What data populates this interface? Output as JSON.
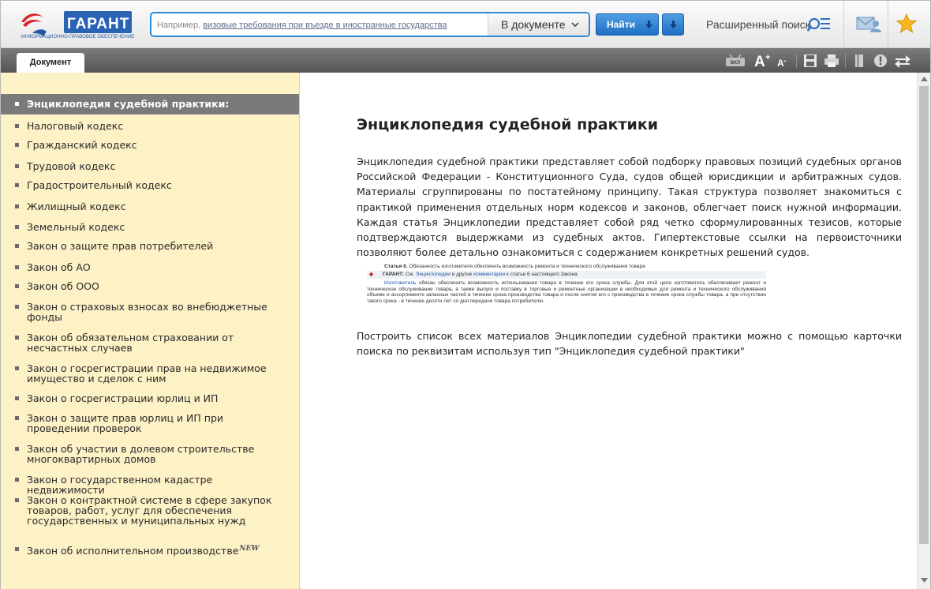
{
  "header": {
    "logo_text": "ГАРАНТ",
    "logo_subtitle": "ИНФОРМАЦИОННО-ПРАВОВОЕ ОБЕСПЕЧЕНИЕ",
    "search_prefix": "Например, ",
    "search_example": "визовые требования при въезде в иностранные государства",
    "scope_value": "В документе",
    "find_label": "Найти",
    "advanced_search_label": "Расширенный поиск",
    "icons": [
      "search-icon",
      "mail-icon",
      "star-icon"
    ],
    "accent_color": "#2d8bd6"
  },
  "tabbar": {
    "tab_label": "Документ",
    "vkl_label": "ВКЛ",
    "font_increase": "A",
    "font_decrease": "A"
  },
  "sidebar": {
    "items": [
      {
        "label": "Энциклопедия судебной практики:",
        "active": true
      },
      {
        "label": "Налоговый кодекс"
      },
      {
        "label": "Гражданский кодекс"
      },
      {
        "label": "Трудовой кодекс"
      },
      {
        "label": "Градостроительный кодекс"
      },
      {
        "label": "Жилищный кодекс"
      },
      {
        "label": "Земельный кодекс"
      },
      {
        "label": "Закон о защите прав потребителей"
      },
      {
        "label": "Закон об АО"
      },
      {
        "label": "Закон об ООО"
      },
      {
        "label": "Закон о страховых взносах во внебюджетные фонды"
      },
      {
        "label": "Закон об обязательном страховании от несчастных случаев"
      },
      {
        "label": "Закон о госрегистрации прав на недвижимое имущество и сделок с ним"
      },
      {
        "label": "Закон о госрегистрации юрлиц и ИП"
      },
      {
        "label": "Закон о защите прав юрлиц и ИП при проведении проверок"
      },
      {
        "label": "Закон об участии в долевом строительстве многоквартирных домов"
      },
      {
        "label": "Закон о государственном кадастре недвижимости"
      },
      {
        "label": "Закон о контрактной системе в сфере закупок товаров, работ, услуг для обеспечения государственных и муниципальных нужд"
      },
      {
        "label": "Закон об исполнительном производстве",
        "badge": "NEW"
      }
    ],
    "background": "#fdf1c6"
  },
  "document": {
    "title": "Энциклопедия судебной практики",
    "paragraph1": "Энциклопедия судебной практики представляет собой подборку правовых позиций судебных органов Российской Федерации - Конституционного Суда, судов общей юрисдикции и арбитражных судов. Материалы сгруппированы по постатейному принципу. Такая структура позволяет знакомиться с практикой применения отдельных норм кодексов и законов, облегчает поиск нужной информации. Каждая статья Энциклопедии представляет собой ряд четко сформулированных тезисов, которые подтверждаются выдержками из судебных актов. Гипертекстовые ссылки на первоисточники позволяют более детально ознакомиться с содержанием конкретных решений судов.",
    "example": {
      "article_label": "Статья 6.",
      "article_text": "Обязанность изготовителя обеспечить возможность ремонта и технического обслуживания товара",
      "garant_label": "ГАРАНТ:",
      "garant_see": "См.",
      "garant_link1": "Энциклопедии",
      "garant_mid": "и другие",
      "garant_link2": "комментарии",
      "garant_tail": "к статье 6 настоящего Закона",
      "body_link": "Изготовитель",
      "body_text": "обязан обеспечить возможность использования товара в течение его срока службы. Для этой цели изготовитель обеспечивает ремонт и техническое обслуживание товара, а также выпуск и поставку в торговые и ремонтные организации в необходимых для ремонта и технического обслуживания объеме и ассортименте запасных частей в течение срока производства товара и после снятия его с производства в течение срока службы товара, а при отсутствии такого срока - в течение десяти лет со дня передачи товара потребителю."
    },
    "paragraph2": "Построить список всех материалов Энциклопедии судебной практики можно с помощью карточки поиска по реквизитам используя тип \"Энциклопедия судебной практики\""
  }
}
